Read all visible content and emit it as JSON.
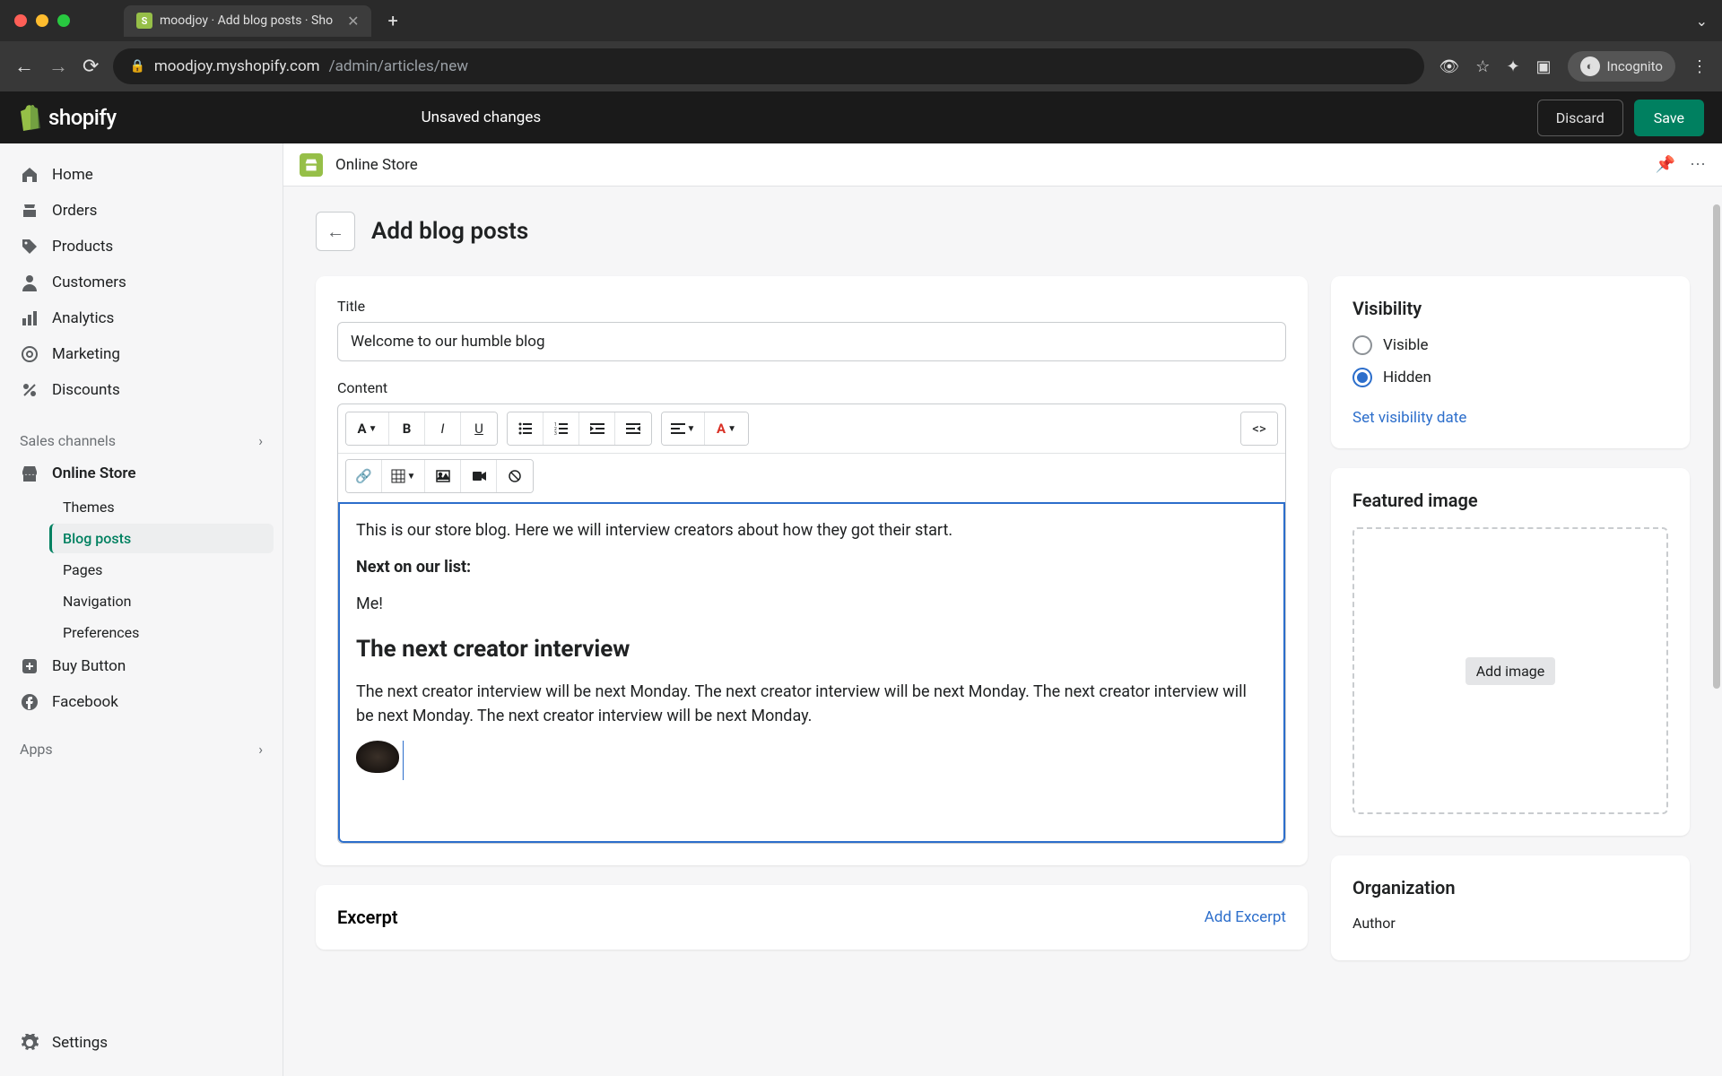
{
  "browser": {
    "tab_title": "moodjoy · Add blog posts · Sho",
    "url_host": "moodjoy.myshopify.com",
    "url_path": "/admin/articles/new",
    "incognito_label": "Incognito"
  },
  "topbar": {
    "brand": "shopify",
    "unsaved_label": "Unsaved changes",
    "discard_label": "Discard",
    "save_label": "Save"
  },
  "sidebar": {
    "items": [
      {
        "label": "Home"
      },
      {
        "label": "Orders"
      },
      {
        "label": "Products"
      },
      {
        "label": "Customers"
      },
      {
        "label": "Analytics"
      },
      {
        "label": "Marketing"
      },
      {
        "label": "Discounts"
      }
    ],
    "channels_header": "Sales channels",
    "online_store_label": "Online Store",
    "online_store_sub": [
      {
        "label": "Themes"
      },
      {
        "label": "Blog posts"
      },
      {
        "label": "Pages"
      },
      {
        "label": "Navigation"
      },
      {
        "label": "Preferences"
      }
    ],
    "buy_button_label": "Buy Button",
    "facebook_label": "Facebook",
    "apps_header": "Apps",
    "settings_label": "Settings"
  },
  "strip": {
    "title": "Online Store"
  },
  "page": {
    "title": "Add blog posts",
    "title_label": "Title",
    "title_value": "Welcome to our humble blog",
    "content_label": "Content",
    "content": {
      "p1": "This is our store blog. Here we will interview creators about how they got their start.",
      "p2": "Next on our list:",
      "p3": "Me!",
      "h2": "The next creator interview",
      "p4": "The next creator interview will be next Monday.  The next creator interview will be next Monday. The next creator interview will be next Monday. The next creator interview will be next Monday."
    },
    "excerpt_label": "Excerpt",
    "add_excerpt_label": "Add Excerpt"
  },
  "visibility": {
    "title": "Visibility",
    "options": [
      "Visible",
      "Hidden"
    ],
    "set_date_label": "Set visibility date"
  },
  "featured_image": {
    "title": "Featured image",
    "add_label": "Add image"
  },
  "organization": {
    "title": "Organization",
    "author_label": "Author"
  }
}
